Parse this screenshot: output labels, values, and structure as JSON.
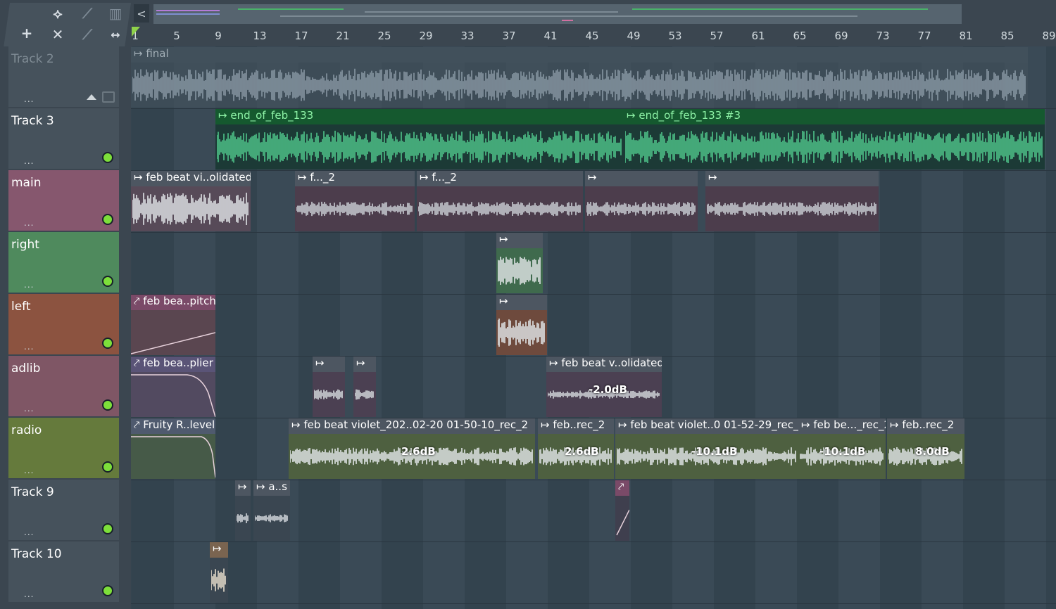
{
  "toolbar": {
    "icons": [
      "waveform-icon",
      "curve-icon",
      "piano-icon",
      "add-icon",
      "delete-icon",
      "slice-icon",
      "stretch-icon"
    ],
    "back_label": "<"
  },
  "ruler": {
    "ticks": [
      "1",
      "5",
      "9",
      "13",
      "17",
      "21",
      "25",
      "29",
      "33",
      "37",
      "41",
      "45",
      "49",
      "53",
      "57",
      "61",
      "65",
      "69",
      "73",
      "77",
      "81",
      "85",
      "89"
    ]
  },
  "tracks": [
    {
      "name": "Track 2",
      "color": "#46525c",
      "muted": true
    },
    {
      "name": "Track 3",
      "color": "#46525c"
    },
    {
      "name": "main",
      "color": "#86576e"
    },
    {
      "name": "right",
      "color": "#4f8a5d"
    },
    {
      "name": "left",
      "color": "#8c5340"
    },
    {
      "name": "adlib",
      "color": "#7f5665"
    },
    {
      "name": "radio",
      "color": "#657a3c"
    },
    {
      "name": "Track 9",
      "color": "#46525c"
    },
    {
      "name": "Track 10",
      "color": "#46525c"
    }
  ],
  "clips": {
    "final": "final",
    "end1": "end_of_feb_133",
    "end2": "end_of_feb_133 #3",
    "main1": "feb beat vi..olidated)",
    "main_f1": "f..._2",
    "main_f2": "f..._2",
    "left_auto": "feb bea..pitch",
    "adlib_auto": "feb bea..plier",
    "adlib_big": "feb beat v..olidated)",
    "adlib_vol": "-2.0dB",
    "radio_auto": "Fruity R..level",
    "radio1": "feb beat violet_202..02-20 01-50-10_rec_2",
    "radio1_vol": "2.6dB",
    "radio2": "feb..rec_2",
    "radio2_vol": "2.6dB",
    "radio3": "feb beat violet..0 01-52-29_rec_",
    "radio3_vol": "-10.1dB",
    "radio4": "feb be..._rec_2",
    "radio4_vol": "-10.1dB",
    "radio5": "feb..rec_2",
    "radio5_vol": "8.0dB",
    "t9_clip": "a..s"
  },
  "colors": {
    "accent_green": "#1f9a4a",
    "wave_green": "#4fc48a",
    "playhead": "#8fd14a"
  }
}
